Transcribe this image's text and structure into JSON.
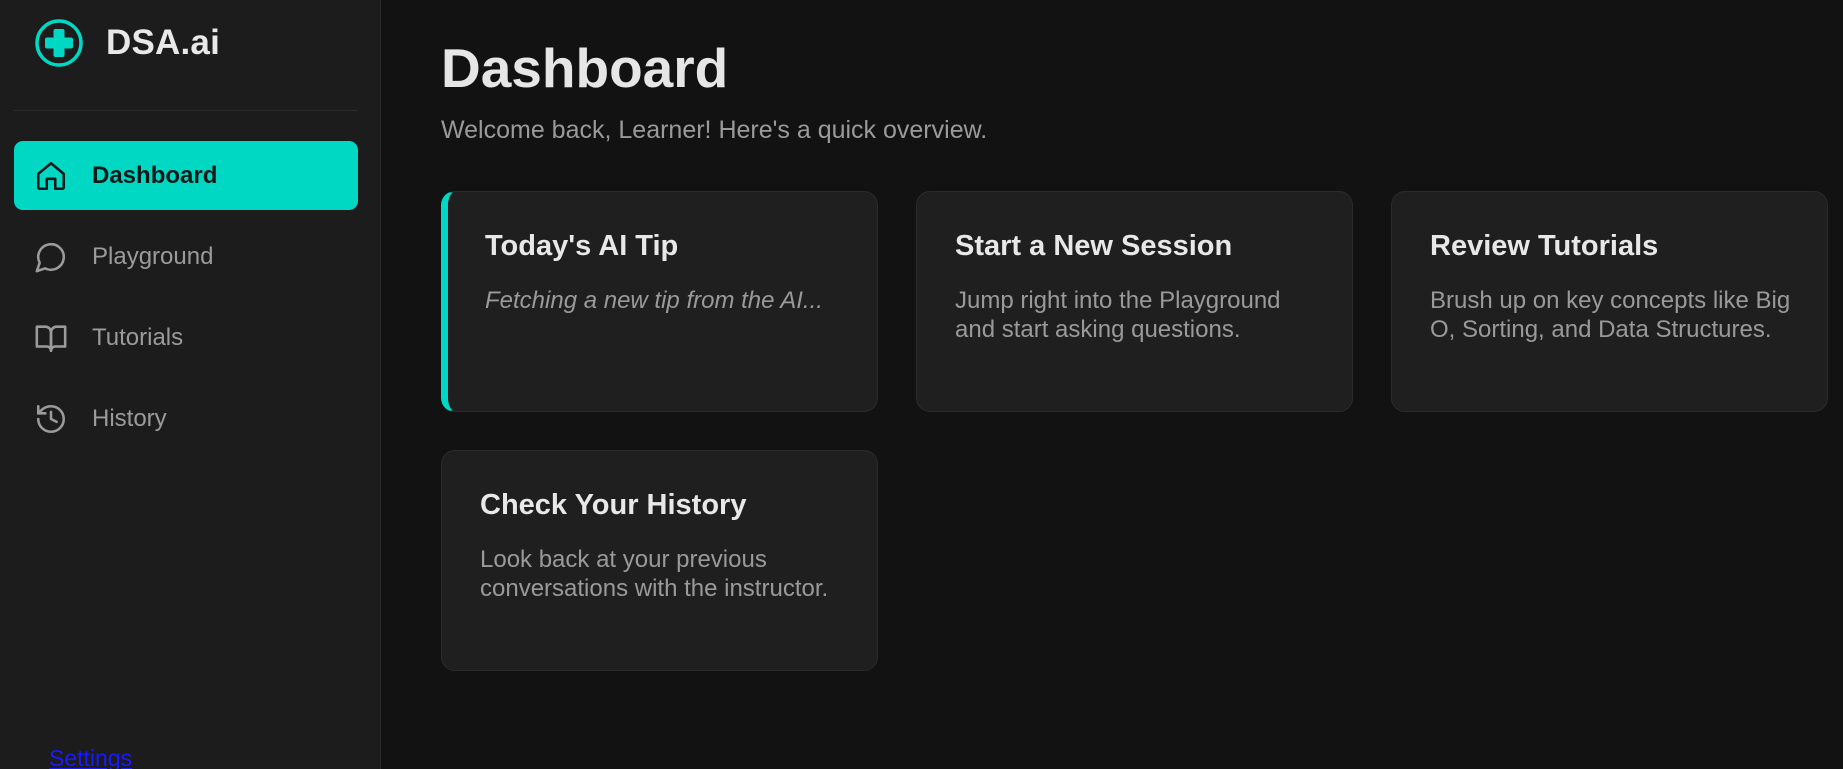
{
  "brand": {
    "name": "DSA.ai",
    "logo_icon": "plus-circle-icon",
    "accent_color": "#00d8c4"
  },
  "sidebar": {
    "items": [
      {
        "label": "Dashboard",
        "icon": "home-icon",
        "active": true
      },
      {
        "label": "Playground",
        "icon": "chat-bubble-icon",
        "active": false
      },
      {
        "label": "Tutorials",
        "icon": "book-open-icon",
        "active": false
      },
      {
        "label": "History",
        "icon": "history-icon",
        "active": false
      }
    ],
    "settings_label": "Settings"
  },
  "main": {
    "title": "Dashboard",
    "subtitle": "Welcome back, Learner! Here's a quick overview.",
    "cards": [
      {
        "title": "Today's AI Tip",
        "text": "Fetching a new tip from the AI..."
      },
      {
        "title": "Start a New Session",
        "text": "Jump right into the Playground and start asking questions."
      },
      {
        "title": "Review Tutorials",
        "text": "Brush up on key concepts like Big O, Sorting, and Data Structures."
      },
      {
        "title": "Check Your History",
        "text": "Look back at your previous conversations with the instructor."
      }
    ]
  }
}
